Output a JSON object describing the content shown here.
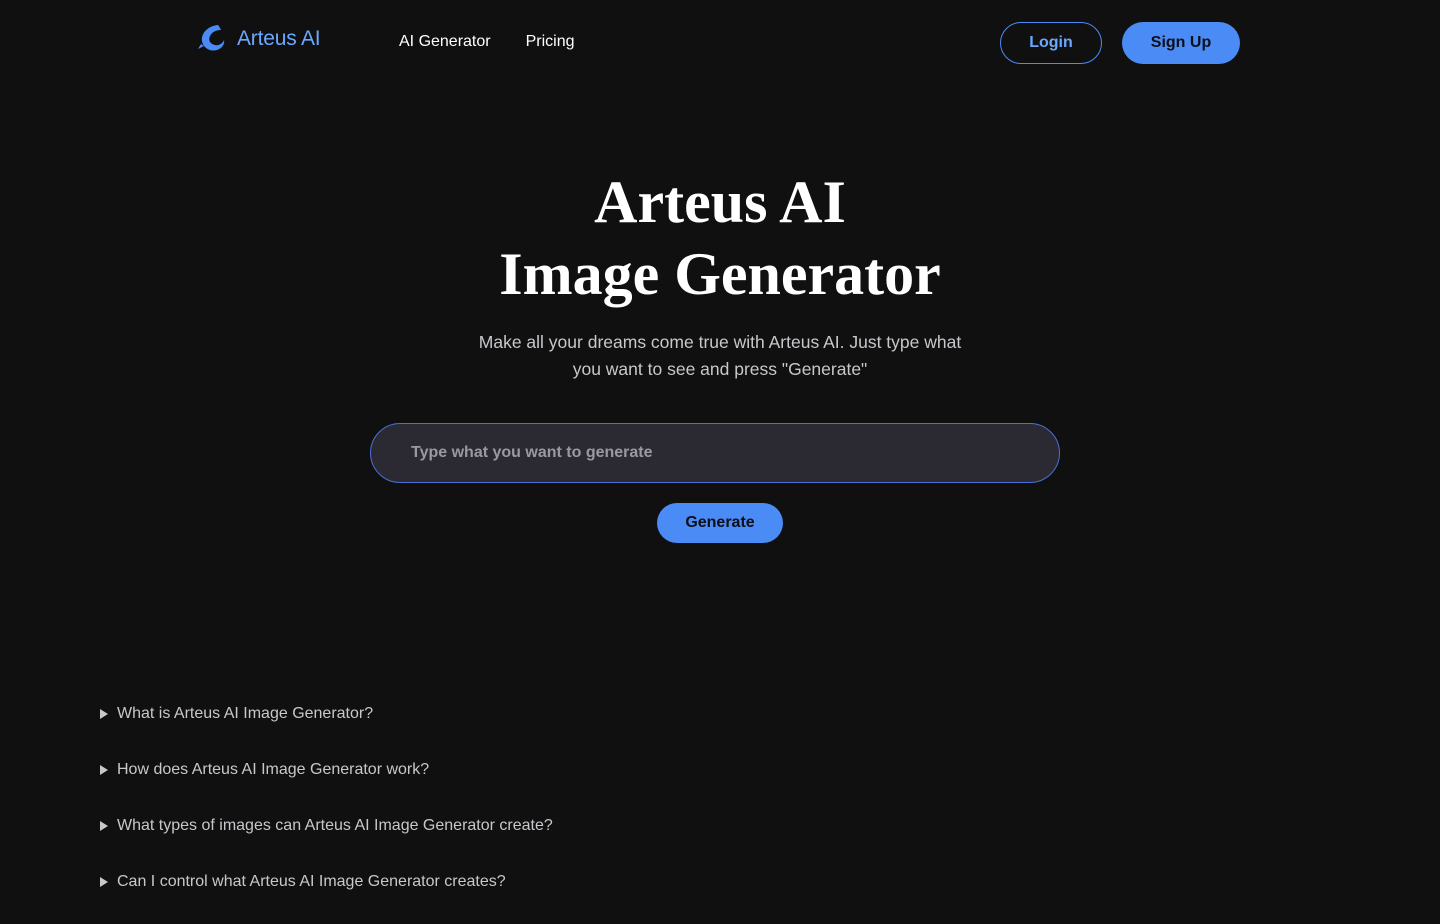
{
  "header": {
    "logo_text": "Arteus AI",
    "logo_icon": "dolphin-icon",
    "nav": [
      {
        "label": "AI Generator"
      },
      {
        "label": "Pricing"
      }
    ],
    "login_label": "Login",
    "signup_label": "Sign Up"
  },
  "hero": {
    "title_line1": "Arteus AI",
    "title_line2": "Image Generator",
    "subtitle": "Make all your dreams come true with Arteus AI. Just type what you want to see and press \"Generate\""
  },
  "prompt": {
    "placeholder": "Type what you want to generate",
    "value": ""
  },
  "generate_label": "Generate",
  "faq": [
    {
      "question": "What is Arteus AI Image Generator?"
    },
    {
      "question": "How does Arteus AI Image Generator work?"
    },
    {
      "question": "What types of images can Arteus AI Image Generator create?"
    },
    {
      "question": "Can I control what Arteus AI Image Generator creates?"
    }
  ],
  "colors": {
    "background": "#101011",
    "accent": "#4a8bf5",
    "logo_text": "#6aa8ff",
    "input_bg": "#2b2a33",
    "muted_text": "#c8c8cc"
  }
}
